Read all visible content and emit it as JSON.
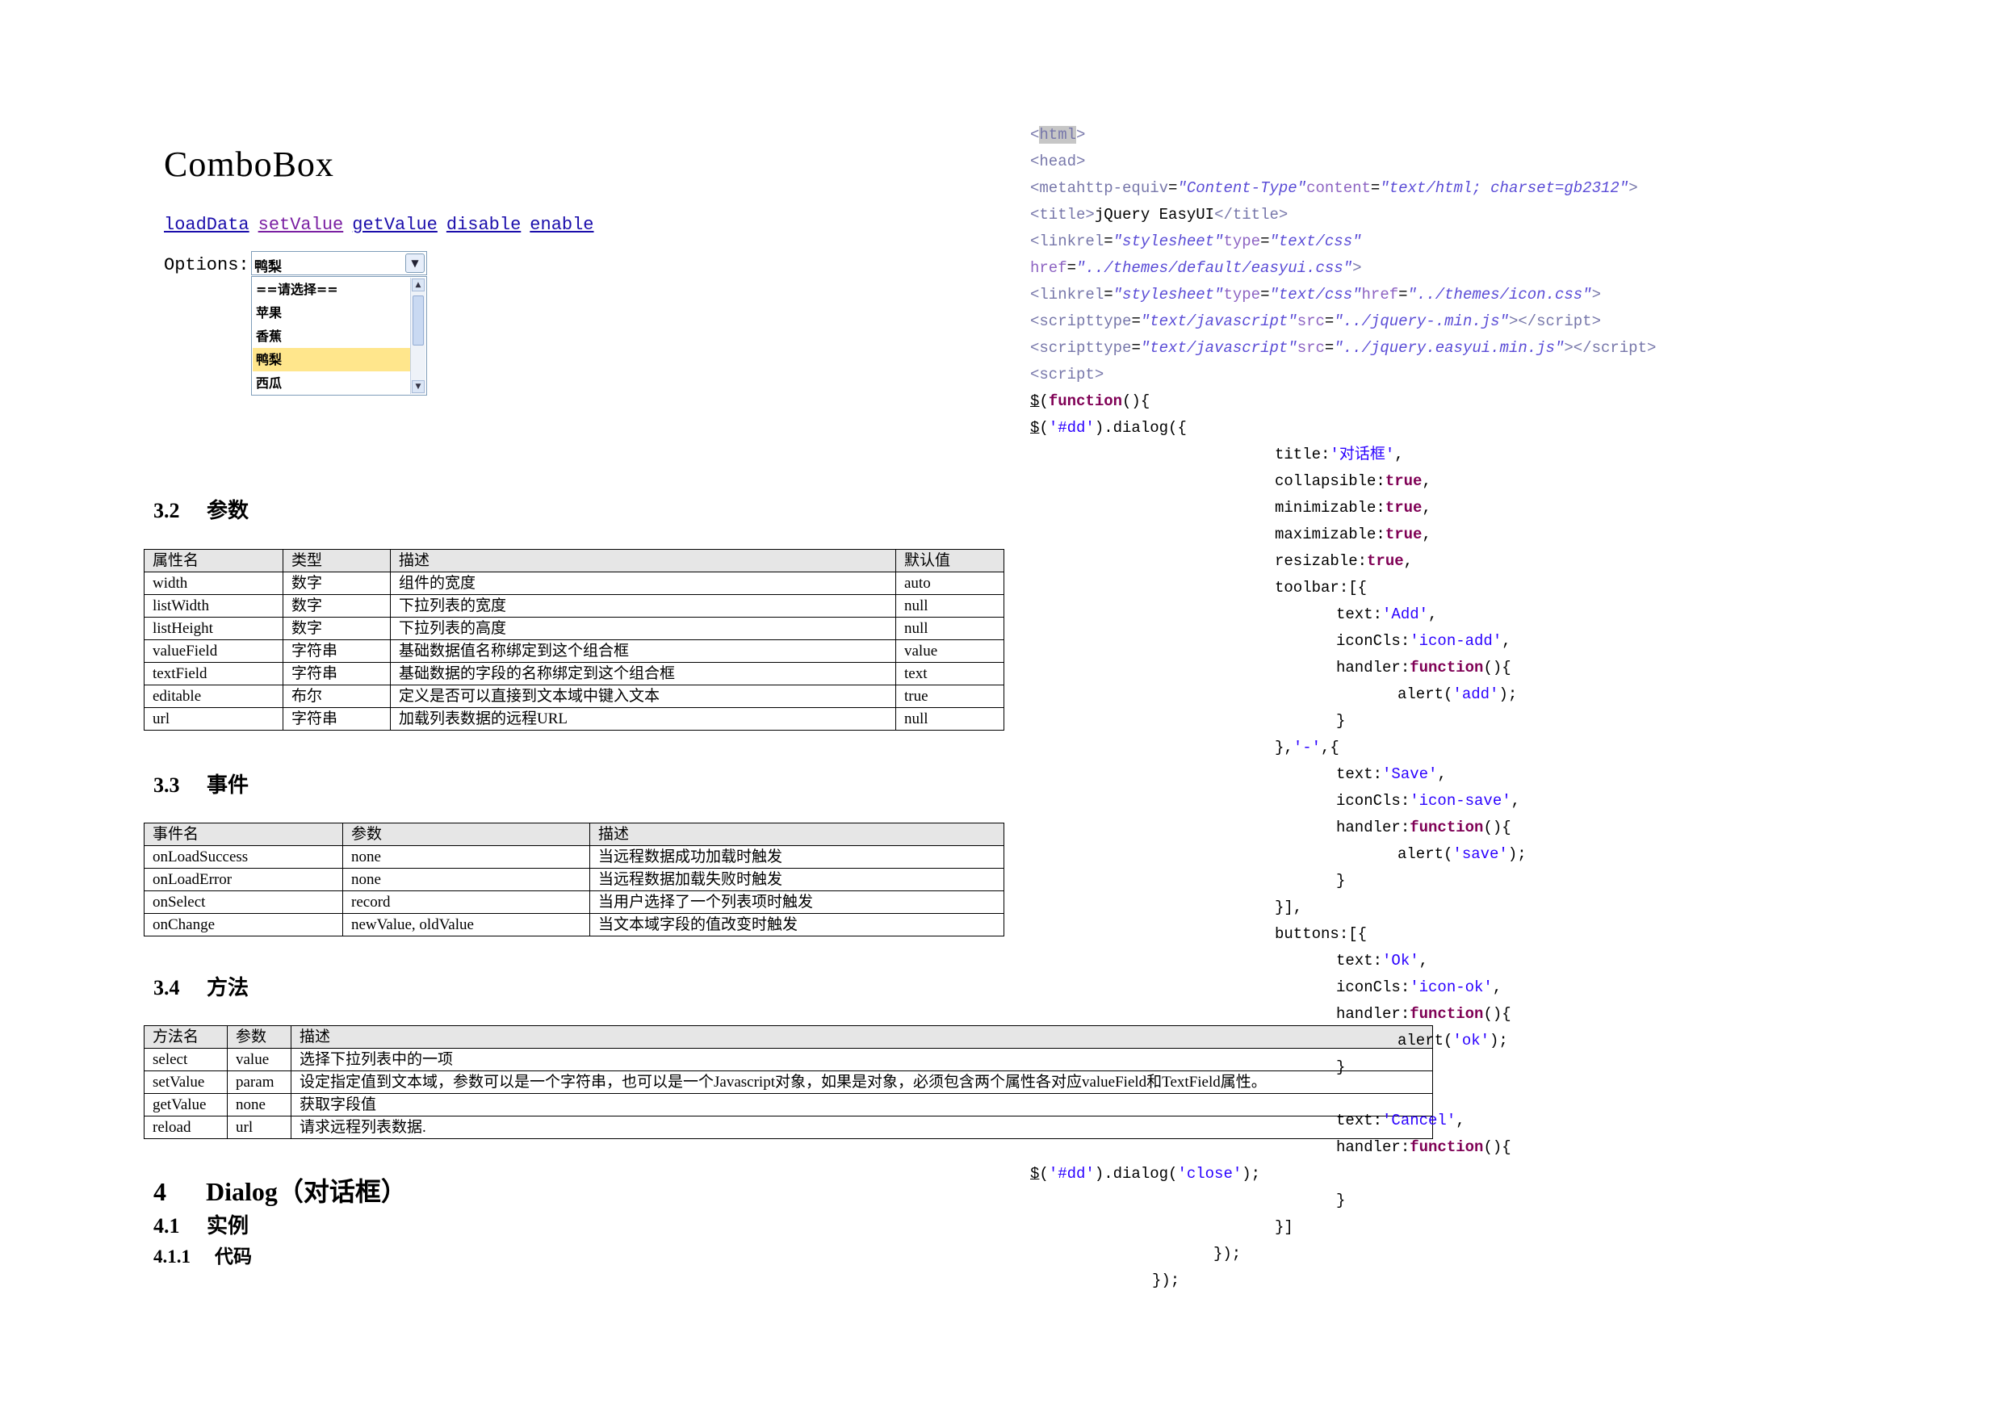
{
  "combobox": {
    "title": "ComboBox",
    "links": [
      "loadData",
      "setValue",
      "getValue",
      "disable",
      "enable"
    ],
    "options_label": "Options:",
    "selected_value": "鸭梨",
    "options": [
      "==请选择==",
      "苹果",
      "香蕉",
      "鸭梨",
      "西瓜"
    ]
  },
  "sections": {
    "s32": {
      "num": "3.2",
      "title": "参数"
    },
    "s33": {
      "num": "3.3",
      "title": "事件"
    },
    "s34": {
      "num": "3.4",
      "title": "方法"
    },
    "s4": {
      "num": "4",
      "title": "Dialog（对话框）"
    },
    "s41": {
      "num": "4.1",
      "title": "实例"
    },
    "s411": {
      "num": "4.1.1",
      "title": "代码"
    }
  },
  "params_table": {
    "headers": [
      "属性名",
      "类型",
      "描述",
      "默认值"
    ],
    "rows": [
      [
        "width",
        "数字",
        "组件的宽度",
        "auto"
      ],
      [
        "listWidth",
        "数字",
        "下拉列表的宽度",
        "null"
      ],
      [
        "listHeight",
        "数字",
        "下拉列表的高度",
        "null"
      ],
      [
        "valueField",
        "字符串",
        "基础数据值名称绑定到这个组合框",
        "value"
      ],
      [
        "textField",
        "字符串",
        "基础数据的字段的名称绑定到这个组合框",
        "text"
      ],
      [
        "editable",
        "布尔",
        "定义是否可以直接到文本域中键入文本",
        "true"
      ],
      [
        "url",
        "字符串",
        "加载列表数据的远程URL",
        "null"
      ]
    ]
  },
  "events_table": {
    "headers": [
      "事件名",
      "参数",
      "描述"
    ],
    "rows": [
      [
        "onLoadSuccess",
        "none",
        "当远程数据成功加载时触发"
      ],
      [
        "onLoadError",
        "none",
        "当远程数据加载失败时触发"
      ],
      [
        "onSelect",
        "record",
        "当用户选择了一个列表项时触发"
      ],
      [
        "onChange",
        "newValue, oldValue",
        "当文本域字段的值改变时触发"
      ]
    ]
  },
  "methods_table": {
    "headers": [
      "方法名",
      "参数",
      "描述"
    ],
    "rows": [
      [
        "select",
        "value",
        "选择下拉列表中的一项"
      ],
      [
        "setValue",
        "param",
        "设定指定值到文本域，参数可以是一个字符串，也可以是一个Javascript对象，如果是对象，必须包含两个属性各对应valueField和TextField属性。"
      ],
      [
        "getValue",
        "none",
        "获取字段值"
      ],
      [
        "reload",
        "url",
        "请求远程列表数据."
      ]
    ]
  },
  "code": {
    "html_open": "html",
    "head_open": "head",
    "meta_tag": "metahttp-equiv",
    "meta_eq": "=",
    "meta_v1": "\"Content-Type\"",
    "meta_a2": "content",
    "meta_v2": "\"text/html; charset=gb2312\"",
    "title_text": "jQuery EasyUI",
    "link1_tag": "linkrel",
    "link1_v1": "\"stylesheet\"",
    "link_type": "type",
    "link1_v2": "\"text/css\"",
    "href": "href",
    "link1_v3": "\"../themes/default/easyui.css\"",
    "link2_tag": "linkrel",
    "link2_v1": "\"stylesheet\"",
    "link2_v2": "\"text/css\"",
    "link2_v3": "\"../themes/icon.css\"",
    "script1_tag": "scripttype",
    "script1_v1": "\"text/javascript\"",
    "src": "src",
    "script1_v2": "\"../jquery-.min.js\"",
    "script2_tag": "scripttype",
    "script2_v1": "\"text/javascript\"",
    "script2_v2": "\"../jquery.easyui.min.js\"",
    "script_open": "script",
    "dollar": "$",
    "function_kw": "function",
    "dd_sel": "'#dd'",
    "dialog": ").dialog({",
    "title_key": "title:",
    "title_val": "'对话框'",
    "collapsible": "collapsible:",
    "minimizable": "minimizable:",
    "maximizable": "maximizable:",
    "resizable": "resizable:",
    "true_kw": "true",
    "toolbar": "toolbar:[{",
    "text_key": "text:",
    "iconcls_key": "iconCls:",
    "handler_key": "handler:",
    "alert": "alert(",
    "add_text": "'Add'",
    "add_icon": "'icon-add'",
    "add_alert": "'add'",
    "sep": "'-'",
    "save_text": "'Save'",
    "save_icon": "'icon-save'",
    "save_alert": "'save'",
    "buttons": "buttons:[{",
    "ok_text": "'Ok'",
    "ok_icon": "'icon-ok'",
    "ok_alert": "'ok'",
    "cancel_text": "'Cancel'",
    "close_str": "'close'",
    "dialog_close": ").dialog("
  },
  "colors": {
    "tag": "#7777aa",
    "attr_value": "#5a4cd6",
    "keyword": "#7f0055",
    "string": "#2a00ff",
    "link": "#1a0dab",
    "visited_link": "#7a1fa2",
    "selected_option": "#ffe68c",
    "table_header": "#e6e6e6"
  },
  "icons": [
    "chevron-down-icon",
    "scroll-up-icon",
    "scroll-down-icon"
  ]
}
